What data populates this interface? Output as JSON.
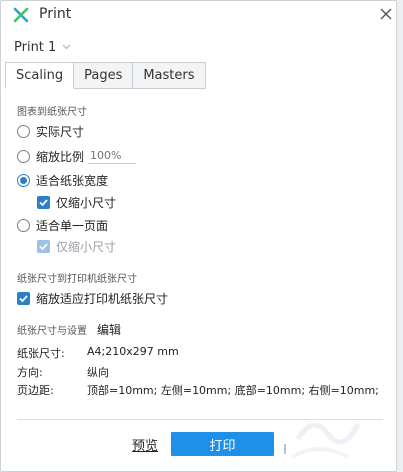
{
  "window": {
    "title": "Print",
    "brand_color": "#1e90e8"
  },
  "profile": {
    "name": "Print 1"
  },
  "tabs": [
    {
      "label": "Scaling",
      "active": true
    },
    {
      "label": "Pages",
      "active": false
    },
    {
      "label": "Masters",
      "active": false
    }
  ],
  "scaling": {
    "section_title": "图表到纸张尺寸",
    "options": {
      "actual": "实际尺寸",
      "scale": "缩放比例",
      "scale_value": "100%",
      "fit_width": "适合纸张宽度",
      "fit_width_shrink": "仅缩小尺寸",
      "fit_page": "适合单一页面",
      "fit_page_shrink": "仅缩小尺寸"
    },
    "selected": "fit_width"
  },
  "printer": {
    "section_title": "纸张尺寸到打印机纸张尺寸",
    "fit_label": "缩放适应打印机纸张尺寸"
  },
  "paper": {
    "section_title": "纸张尺寸与设置",
    "edit_label": "编辑",
    "rows": [
      {
        "key": "纸张尺寸:",
        "value": "A4;210x297 mm"
      },
      {
        "key": "方向:",
        "value": "纵向"
      },
      {
        "key": "页边距:",
        "value": "顶部=10mm; 左侧=10mm; 底部=10mm; 右侧=10mm;"
      }
    ]
  },
  "footer": {
    "preview_label": "预览",
    "print_label": "打印"
  },
  "icons": {
    "logo": "x-logo-icon",
    "close": "close-icon",
    "dropdown": "chevron-down-icon"
  }
}
